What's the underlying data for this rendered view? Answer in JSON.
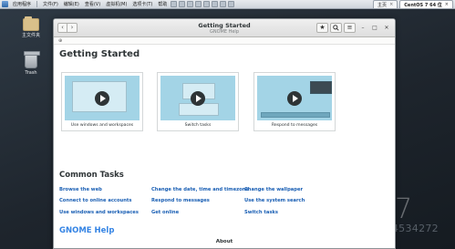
{
  "host": {
    "app_menu": "应用程序",
    "menu": [
      "文件(F)",
      "编辑(E)",
      "查看(V)",
      "虚拟机(M)",
      "选项卡(T)",
      "帮助"
    ],
    "tabs": [
      {
        "label": "主页",
        "active": false
      },
      {
        "label": "CentOS 7 64 位",
        "active": true
      }
    ]
  },
  "desktop": {
    "icons": [
      {
        "label": "主文件夹",
        "icon": "folder-icon"
      },
      {
        "label": "Trash",
        "icon": "trash-icon"
      }
    ],
    "os_version_digit": "7",
    "watermark": "http://blog.csdn.net/a844534272"
  },
  "window": {
    "title": "Getting Started",
    "subtitle": "GNOME Help",
    "buttons": [
      "bookmark-icon",
      "search-icon",
      "menu-icon"
    ],
    "controls": [
      "minimize-icon",
      "maximize-icon",
      "close-icon"
    ]
  },
  "page": {
    "title": "Getting Started",
    "videos": [
      {
        "caption": "Use windows and workspaces"
      },
      {
        "caption": "Switch tasks"
      },
      {
        "caption": "Respond to messages"
      }
    ],
    "common_tasks_title": "Common Tasks",
    "tasks": [
      [
        "Browse the web",
        "Change the date, time and timezone",
        "Change the wallpaper"
      ],
      [
        "Connect to online accounts",
        "Respond to messages",
        "Use the system search"
      ],
      [
        "Use windows and workspaces",
        "Get online",
        "Switch tasks"
      ]
    ],
    "help_heading": "GNOME Help",
    "about_label": "About"
  },
  "colors": {
    "link": "#1a5fb4",
    "help_heading": "#3584e4",
    "video_bg": "#a3d4e6"
  }
}
